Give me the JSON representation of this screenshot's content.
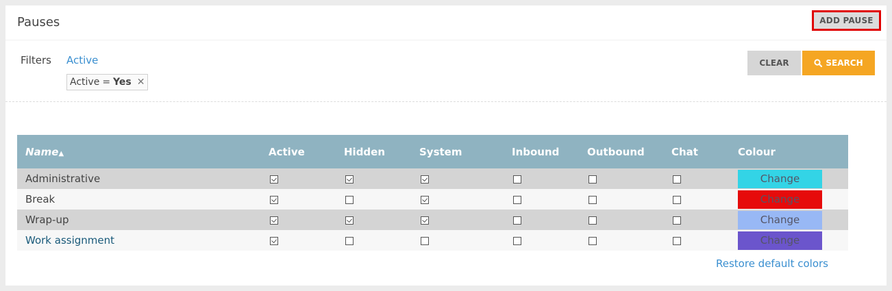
{
  "header": {
    "title": "Pauses",
    "add_button": "ADD PAUSE"
  },
  "filters": {
    "label": "Filters",
    "link": "Active",
    "chip": {
      "key": "Active",
      "op": "=",
      "value": "Yes",
      "remove_icon": "close-icon"
    }
  },
  "actions": {
    "clear": "CLEAR",
    "search": "SEARCH",
    "search_icon": "search-icon"
  },
  "table": {
    "columns": [
      "Name",
      "Active",
      "Hidden",
      "System",
      "Inbound",
      "Outbound",
      "Chat",
      "Colour"
    ],
    "sort_indicator": "▲",
    "rows": [
      {
        "name": "Administrative",
        "active": true,
        "hidden": true,
        "system": true,
        "inbound": false,
        "outbound": false,
        "chat": false,
        "colour_label": "Change",
        "colour": "#33d4e6"
      },
      {
        "name": "Break",
        "active": true,
        "hidden": false,
        "system": true,
        "inbound": false,
        "outbound": false,
        "chat": false,
        "colour_label": "Change",
        "colour": "#e60b0b"
      },
      {
        "name": "Wrap-up",
        "active": true,
        "hidden": true,
        "system": true,
        "inbound": false,
        "outbound": false,
        "chat": false,
        "colour_label": "Change",
        "colour": "#98b8f5"
      },
      {
        "name": "Work assignment",
        "active": true,
        "hidden": false,
        "system": false,
        "inbound": false,
        "outbound": false,
        "chat": false,
        "colour_label": "Change",
        "colour": "#6b55cc"
      }
    ]
  },
  "restore_link": "Restore default colors",
  "colors": {
    "header_bg": "#8fb3c1",
    "search_bg": "#f5a623",
    "link": "#3a8fd0",
    "highlight_border": "#e00000"
  }
}
